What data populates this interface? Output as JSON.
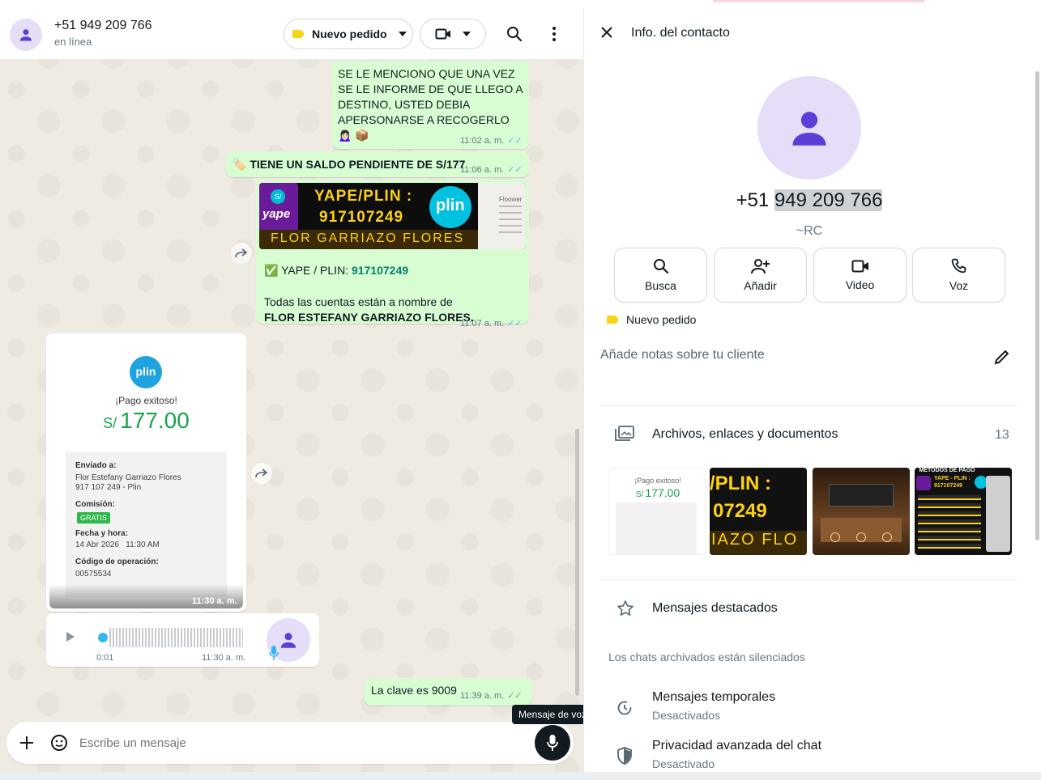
{
  "chat": {
    "contact_name": "+51 949 209 766",
    "status": "en línea",
    "label_pill": "Nuevo pedido",
    "icons": {
      "avatar": "person-icon",
      "video": "video-camera-icon",
      "search": "search-icon",
      "menu": "more-vert-icon"
    }
  },
  "messages": {
    "m1_text": "SE LE MENCIONO QUE UNA VEZ SE LE INFORME DE QUE LLEGO A DESTINO, USTED DEBIA APERSONARSE A RECOGERLO 🙍🏻‍♀️ 📦",
    "m1_time": "11:02 a. m.",
    "m2_text": "🏷️ TIENE UN SALDO PENDIENTE DE S/177",
    "m2_time": "11:06 a. m.",
    "m3_banner_title": "YAPE/PLIN :",
    "m3_banner_number": "917107249",
    "m3_banner_name": "FLOR GARRIAZO FLORES",
    "m3_banner_yape": "yape",
    "m3_banner_plin": "plin",
    "m3_banner_side": "Floower",
    "m3_line1_prefix": "✅ YAPE / PLIN: ",
    "m3_line1_number": "917107249",
    "m3_line2": "Todas las cuentas están a nombre de",
    "m3_line3": "FLOR ESTEFANY GARRIAZO FLORES.",
    "m3_time": "11:07 a. m.",
    "receipt": {
      "logo": "plin",
      "success": "¡Pago exitoso!",
      "currency": "S/",
      "amount": "177.00",
      "sent_to_label": "Enviado a:",
      "sent_to_name": "Flor Estefany Garriazo Flores",
      "sent_to_phone": "917 107 249 - Plin",
      "fee_label": "Comisión:",
      "fee_badge": "GRATIS",
      "date_label": "Fecha y hora:",
      "date_value": "14 Abr 2026   11:30 AM",
      "op_label": "Código de operación:",
      "op_value": "00575534",
      "time": "11:30 a. m."
    },
    "voice": {
      "duration": "0:01",
      "time": "11:30 a. m."
    },
    "m6_text": "La clave es 9009",
    "m6_time": "11:39 a. m."
  },
  "composer": {
    "placeholder": "Escribe un mensaje",
    "tooltip": "Mensaje de voz",
    "icons": {
      "add": "plus-icon",
      "sticker": "sticker-icon",
      "mic": "mic-icon"
    }
  },
  "info": {
    "title": "Info. del contacto",
    "phone_prefix": "+51 ",
    "phone_highlight": "949 209 766",
    "alias": "~RC",
    "actions": [
      {
        "label": "Busca",
        "icon": "search-icon"
      },
      {
        "label": "Añadir",
        "icon": "add-person-icon"
      },
      {
        "label": "Video",
        "icon": "video-camera-icon"
      },
      {
        "label": "Voz",
        "icon": "phone-icon"
      }
    ],
    "label": "Nuevo pedido",
    "notes_placeholder": "Añade notas sobre tu cliente",
    "media_title": "Archivos, enlaces y documentos",
    "media_count": "13",
    "thumb1": {
      "success": "¡Pago exitoso!",
      "currency": "S/",
      "amount": "177.00"
    },
    "thumb2": {
      "line1": "/PLIN :",
      "line2": "07249",
      "line3": "IAZO FLO"
    },
    "thumb4": {
      "title": "METODOS DE PAGO",
      "sub": "YAPE - PLIN :",
      "num": "917107249"
    },
    "starred": "Mensajes destacados",
    "archived_note": "Los chats archivados están silenciados",
    "temporary_title": "Mensajes temporales",
    "temporary_sub": "Desactivados",
    "privacy_title": "Privacidad avanzada del chat",
    "privacy_sub": "Desactivado"
  },
  "colors": {
    "accent": "#25d366",
    "bubble_out": "#d9fdd3",
    "bg": "#efeae2",
    "tick_blue": "#53bdeb",
    "avatar_bg": "#e6def8",
    "avatar_fg": "#5b3fd6"
  }
}
